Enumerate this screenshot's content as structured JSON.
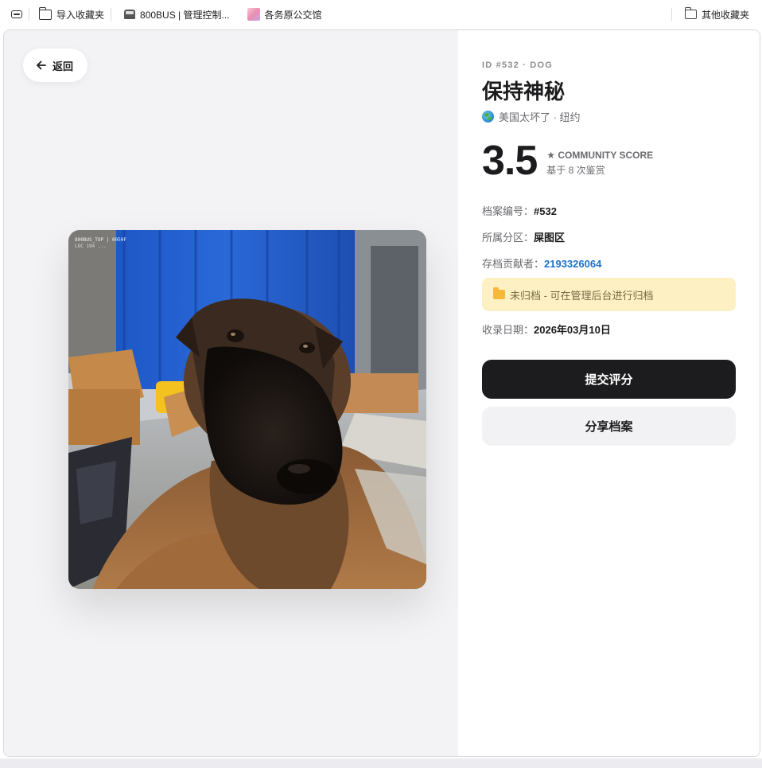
{
  "bookmarks_bar": {
    "items": [
      {
        "label": "导入收藏夹",
        "icon": "folder-import-icon"
      },
      {
        "label": "800BUS | 管理控制...",
        "icon": "bus-icon"
      },
      {
        "label": "各务原公交馆",
        "icon": "anime-avatar-icon"
      }
    ],
    "other_label": "其他收藏夹"
  },
  "back_button": {
    "label": "返回",
    "icon": "arrow-left-icon"
  },
  "photo": {
    "description_icon": "dog-photo",
    "overlay_line1": "800BUS_TOP | 0050F",
    "overlay_line2": "LOC 194 ..."
  },
  "detail": {
    "meta": "ID #532 · DOG",
    "title": "保持神秘",
    "location": "美国太坏了 · 纽约",
    "score": "3.5",
    "score_label": "★ COMMUNITY SCORE",
    "score_sub": "基于 8 次鉴赏",
    "fields": {
      "archive_no_label": "档案编号：",
      "archive_no": "#532",
      "zone_label": "所属分区：",
      "zone": "屎图区",
      "contributor_label": "存档贡献者：",
      "contributor": "2193326064",
      "date_label": "收录日期：",
      "date": "2026年03月10日"
    },
    "notice": "未归档 - 可在管理后台进行归档",
    "submit_label": "提交评分",
    "share_label": "分享档案"
  },
  "colors": {
    "accent_link": "#1a73c8",
    "primary_button": "#1c1c1e",
    "notice_bg": "#fdf0c2"
  }
}
